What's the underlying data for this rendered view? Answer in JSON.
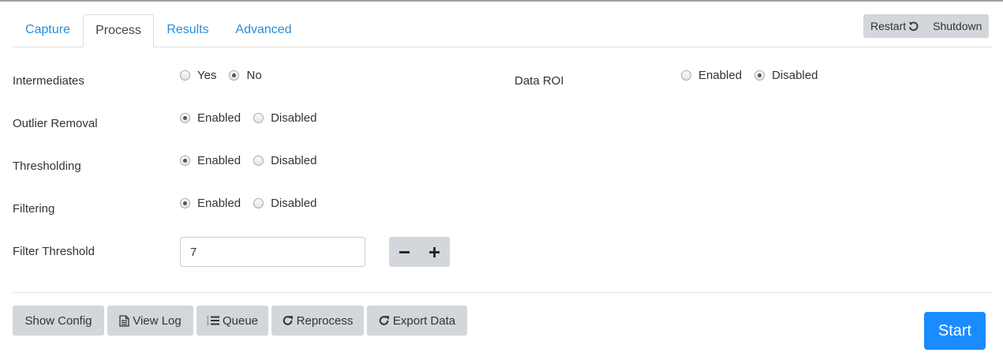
{
  "tabs": [
    {
      "label": "Capture"
    },
    {
      "label": "Process"
    },
    {
      "label": "Results"
    },
    {
      "label": "Advanced"
    }
  ],
  "system": {
    "restart_label": "Restart",
    "shutdown_label": "Shutdown"
  },
  "form": {
    "intermediates": {
      "label": "Intermediates",
      "options": [
        "Yes",
        "No"
      ],
      "selected": "No"
    },
    "outlier_removal": {
      "label": "Outlier Removal",
      "options": [
        "Enabled",
        "Disabled"
      ],
      "selected": "Enabled"
    },
    "thresholding": {
      "label": "Thresholding",
      "options": [
        "Enabled",
        "Disabled"
      ],
      "selected": "Enabled"
    },
    "filtering": {
      "label": "Filtering",
      "options": [
        "Enabled",
        "Disabled"
      ],
      "selected": "Enabled"
    },
    "filter_threshold": {
      "label": "Filter Threshold",
      "value": "7"
    },
    "data_roi": {
      "label": "Data ROI",
      "options": [
        "Enabled",
        "Disabled"
      ],
      "selected": "Disabled"
    }
  },
  "actions": {
    "show_config": "Show Config",
    "view_log": "View Log",
    "queue": "Queue",
    "reprocess": "Reprocess",
    "export_data": "Export Data",
    "start": "Start"
  },
  "active_tab": "Process"
}
